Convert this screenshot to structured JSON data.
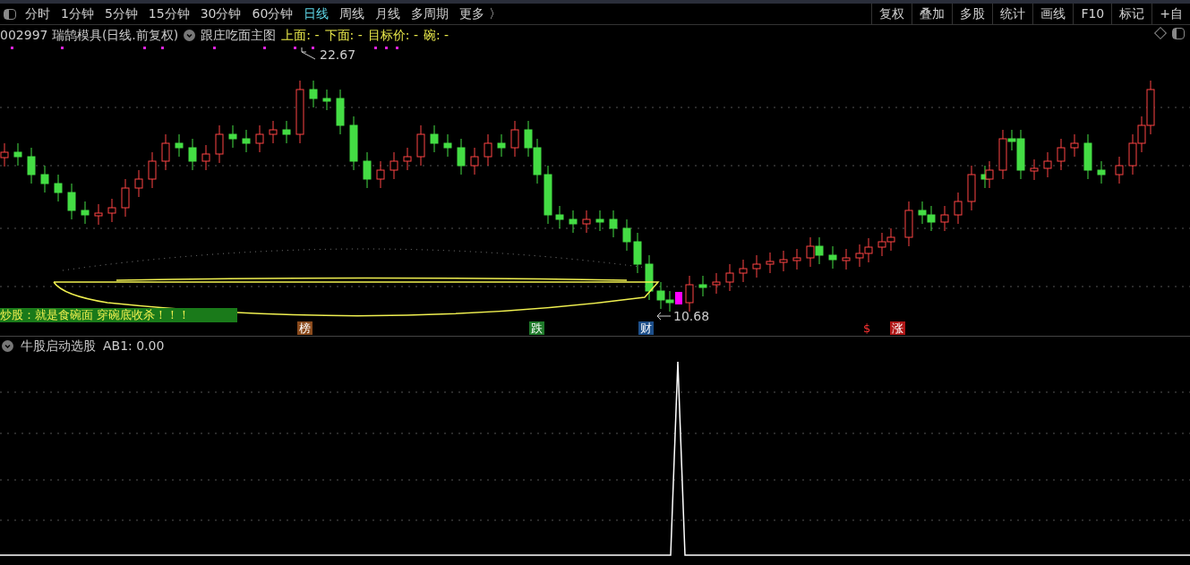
{
  "periods": [
    {
      "label": "分时",
      "selected": false
    },
    {
      "label": "1分钟",
      "selected": false
    },
    {
      "label": "5分钟",
      "selected": false
    },
    {
      "label": "15分钟",
      "selected": false
    },
    {
      "label": "30分钟",
      "selected": false
    },
    {
      "label": "60分钟",
      "selected": false
    },
    {
      "label": "日线",
      "selected": true
    },
    {
      "label": "周线",
      "selected": false
    },
    {
      "label": "月线",
      "selected": false
    },
    {
      "label": "多周期",
      "selected": false
    },
    {
      "label": "更多 〉",
      "selected": false
    }
  ],
  "tools": [
    "复权",
    "叠加",
    "多股",
    "统计",
    "画线",
    "F10",
    "标记",
    "+自"
  ],
  "main_chart": {
    "stock": "002997 瑞鹄模具(日线.前复权)",
    "indicator": "跟庄吃面主图",
    "fields": [
      "上面: -",
      "下面: -",
      "目标价: -",
      "碗: -"
    ],
    "high_label": "22.67",
    "low_label": "10.68",
    "banner": "炒股：就是食碗面 穿碗底收杀！！！",
    "markers": [
      {
        "text": "榜",
        "color": "#8a4a1c"
      },
      {
        "text": "跌",
        "color": "#1f7a2a"
      },
      {
        "text": "财",
        "color": "#1d4f8a"
      },
      {
        "text": "$",
        "color": "#000000"
      },
      {
        "text": "涨",
        "color": "#b01818"
      }
    ]
  },
  "sub_chart": {
    "indicator": "牛股启动选股",
    "reading": "AB1: 0.00"
  }
}
